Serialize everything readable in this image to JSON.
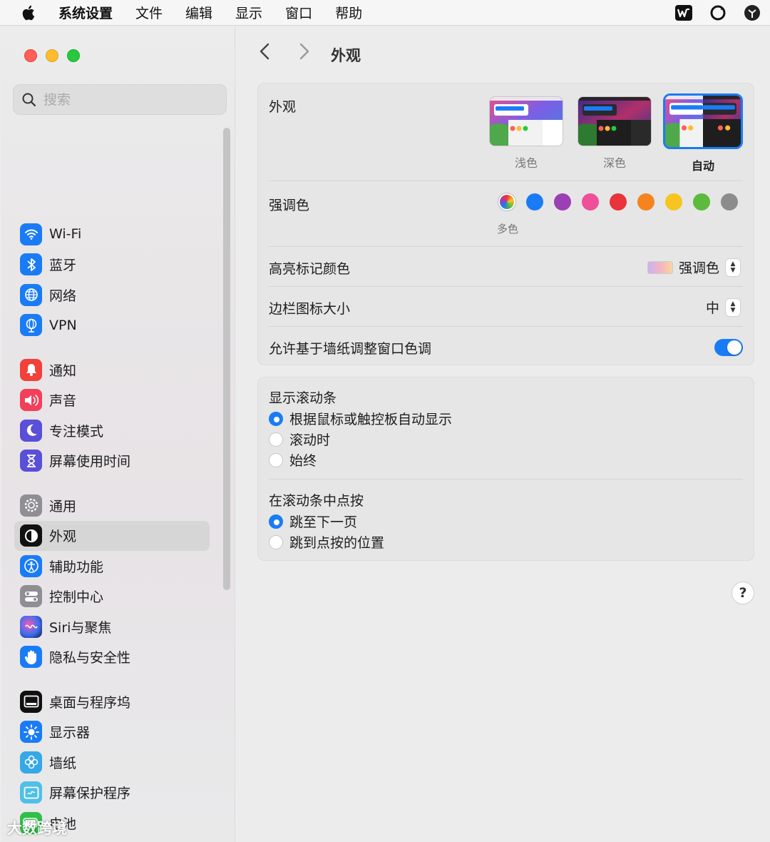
{
  "menubar": {
    "apple_icon": "apple-icon",
    "items": [
      "系统设置",
      "文件",
      "编辑",
      "显示",
      "窗口",
      "帮助"
    ],
    "status_icons": [
      "wps-icon",
      "sync-icon",
      "shield-icon"
    ]
  },
  "sidebar": {
    "search_placeholder": "搜索",
    "groups": [
      [
        {
          "label": "Wi-Fi",
          "icon": "wifi-icon",
          "color": "#1a7cf5"
        },
        {
          "label": "蓝牙",
          "icon": "bluetooth-icon",
          "color": "#1a7cf5"
        },
        {
          "label": "网络",
          "icon": "globe-icon",
          "color": "#1a7cf5"
        },
        {
          "label": "VPN",
          "icon": "vpn-globe-icon",
          "color": "#1a7cf5"
        }
      ],
      [
        {
          "label": "通知",
          "icon": "bell-icon",
          "color": "#f2403a"
        },
        {
          "label": "声音",
          "icon": "speaker-icon",
          "color": "#f2405a"
        },
        {
          "label": "专注模式",
          "icon": "moon-icon",
          "color": "#5a4fd8"
        },
        {
          "label": "屏幕使用时间",
          "icon": "hourglass-icon",
          "color": "#5a4fd8"
        }
      ],
      [
        {
          "label": "通用",
          "icon": "gear-icon",
          "color": "#8e8e93"
        },
        {
          "label": "外观",
          "icon": "appearance-icon",
          "color": "#111111",
          "active": true
        },
        {
          "label": "辅助功能",
          "icon": "accessibility-icon",
          "color": "#1a7cf5"
        },
        {
          "label": "控制中心",
          "icon": "toggles-icon",
          "color": "#8e8e93"
        },
        {
          "label": "Siri与聚焦",
          "icon": "siri-icon",
          "color": "#3a2a6a"
        },
        {
          "label": "隐私与安全性",
          "icon": "hand-icon",
          "color": "#1a7cf5"
        }
      ],
      [
        {
          "label": "桌面与程序坞",
          "icon": "dock-icon",
          "color": "#111111"
        },
        {
          "label": "显示器",
          "icon": "sun-icon",
          "color": "#1a7cf5"
        },
        {
          "label": "墙纸",
          "icon": "flower-icon",
          "color": "#35a8e8"
        },
        {
          "label": "屏幕保护程序",
          "icon": "screensaver-icon",
          "color": "#4fc0e8"
        },
        {
          "label": "电池",
          "icon": "battery-icon",
          "color": "#30c048"
        }
      ]
    ]
  },
  "content": {
    "title": "外观",
    "appearance": {
      "label": "外观",
      "themes": [
        {
          "label": "浅色",
          "selected": false
        },
        {
          "label": "深色",
          "selected": false
        },
        {
          "label": "自动",
          "selected": true
        }
      ]
    },
    "accent": {
      "label": "强调色",
      "caption": "多色",
      "colors": [
        "multicolor",
        "#1a7cf5",
        "#9b3fb5",
        "#f0509a",
        "#e8343a",
        "#f5841f",
        "#f8c420",
        "#5cbb3c",
        "#8c8c8c"
      ]
    },
    "highlight": {
      "label": "高亮标记颜色",
      "value": "强调色"
    },
    "sidebar_icon_size": {
      "label": "边栏图标大小",
      "value": "中"
    },
    "wallpaper_tint": {
      "label": "允许基于墙纸调整窗口色调",
      "on": true
    },
    "scrollbars": {
      "label": "显示滚动条",
      "options": [
        {
          "label": "根据鼠标或触控板自动显示",
          "selected": true
        },
        {
          "label": "滚动时",
          "selected": false
        },
        {
          "label": "始终",
          "selected": false
        }
      ]
    },
    "click_in_scrollbar": {
      "label": "在滚动条中点按",
      "options": [
        {
          "label": "跳至下一页",
          "selected": true
        },
        {
          "label": "跳到点按的位置",
          "selected": false
        }
      ]
    },
    "help": "?"
  },
  "watermark": "大数跨境"
}
